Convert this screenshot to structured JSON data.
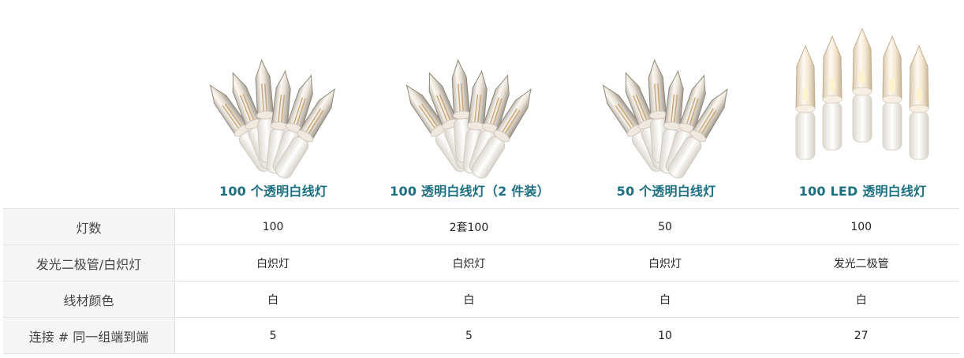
{
  "products": [
    {
      "title": "100 个透明白线灯",
      "image": "clear-bulb-string-lights-white-wire"
    },
    {
      "title": "100 透明白线灯（2 件装）",
      "image": "clear-bulb-string-lights-white-wire"
    },
    {
      "title": "50 个透明白线灯",
      "image": "clear-bulb-string-lights-white-wire"
    },
    {
      "title": "100 LED 透明白线灯",
      "image": "warm-led-bulb-string-lights-white-wire"
    }
  ],
  "rows": [
    {
      "label": "灯数",
      "values": [
        "100",
        "2套100",
        "50",
        "100"
      ]
    },
    {
      "label": "发光二极管/白炽灯",
      "values": [
        "白炽灯",
        "白炽灯",
        "白炽灯",
        "发光二极管"
      ]
    },
    {
      "label": "线材颜色",
      "values": [
        "白",
        "白",
        "白",
        "白"
      ]
    },
    {
      "label": "连接 # 同一组端到端",
      "values": [
        "5",
        "5",
        "10",
        "27"
      ]
    }
  ],
  "colors": {
    "title": "#1c6f80",
    "label_bg": "#f5f5f5",
    "border": "#e2e2e2"
  }
}
